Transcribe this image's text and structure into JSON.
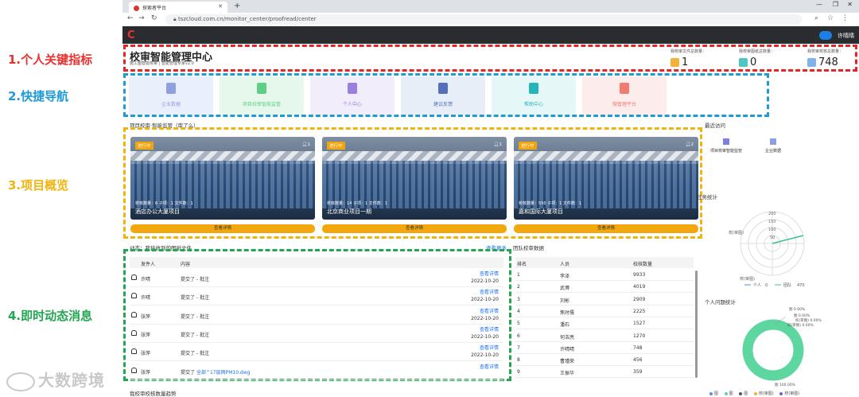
{
  "annotations": {
    "kpi": "1.个人关键指标",
    "nav": "2.快捷导航",
    "projects": "3.项目概览",
    "feed": "4.即时动态消息"
  },
  "watermark": "大数跨境",
  "browser": {
    "tab_title": "探索者平台",
    "url": "tszcloud.com.cn/monitor_center/proofread/center"
  },
  "user": {
    "name": "许晴晴"
  },
  "header": {
    "title": "校审智能管理中心",
    "subtitle": "施工图智能校审 | 智能管理专家v2.0"
  },
  "kpis": [
    {
      "label": "我校审文件总数量：",
      "value": "1",
      "color": "#f5b23b"
    },
    {
      "label": "我校审图纸总数量：",
      "value": "0",
      "color": "#4fc6c3"
    },
    {
      "label": "我校审校核总数量：",
      "value": "748",
      "color": "#7fb2ea"
    }
  ],
  "nav": [
    {
      "label": "企业数据",
      "bg": "#eaf0fb",
      "icon": "#8f9fdf"
    },
    {
      "label": "项目校审智能监管",
      "bg": "#e6f8ec",
      "icon": "#5fcf86"
    },
    {
      "label": "个人中心",
      "bg": "#f1edfb",
      "icon": "#9a7fe0"
    },
    {
      "label": "建议反馈",
      "bg": "#e8eef8",
      "icon": "#5470b8"
    },
    {
      "label": "帮助中心",
      "bg": "#e6f7f8",
      "icon": "#25b5b8"
    },
    {
      "label": "微管理平台",
      "bg": "#fdecec",
      "icon": "#f07b70"
    }
  ],
  "projects_section": {
    "title": "项目校审·智能监管（审了么）"
  },
  "projects": [
    {
      "badge": "进行中",
      "count": "1",
      "stats": "校核数量：6   子项：1   文件数：1",
      "name": "酒店办公大厦项目",
      "button": "查看详情"
    },
    {
      "badge": "进行中",
      "count": "1",
      "stats": "校核数量：14   子项：1   文件数：1",
      "name": "北京商业项目一期",
      "button": "查看详情"
    },
    {
      "badge": "进行中",
      "count": "2",
      "stats": "校核数量：550   子项：1   文件数：1",
      "name": "嘉和国际大厦项目",
      "button": "查看详情"
    }
  ],
  "recent": {
    "title": "最近访问",
    "items": [
      "项目校审智能监管",
      "企业数据"
    ]
  },
  "task_stats": {
    "title": "任务统计",
    "ticks": [
      "200",
      "150",
      "100",
      "50"
    ],
    "labels": [
      "校(审图)",
      "校(审图)"
    ],
    "legend": [
      "个人",
      "0",
      "团队",
      "470"
    ]
  },
  "personal": {
    "title": "个人问题统计",
    "labels": [
      "图 0.00%",
      "图 0.00%",
      "校(审图) 0.00%",
      "校(审图) 0.00%"
    ],
    "bottom_label": "图 100.00%",
    "legend": [
      "图",
      "图",
      "图",
      "校(审图)",
      "校(审图)"
    ]
  },
  "feed": {
    "title": "动态：我接收到的图纸文件",
    "more": "查看更多",
    "col_sender": "发件人",
    "col_content": "内容",
    "rows": [
      {
        "sender": "许晴",
        "content": "提交了 - 批注",
        "link": "查看详情",
        "date": "2022-10-20"
      },
      {
        "sender": "许晴",
        "content": "提交了 - 批注",
        "link": "查看详情",
        "date": "2022-10-20"
      },
      {
        "sender": "张萍",
        "content": "提交了 - 批注",
        "link": "查看详情",
        "date": "2022-10-20"
      },
      {
        "sender": "张萍",
        "content": "提交了 - 批注",
        "link": "查看详情",
        "date": "2022-10-20"
      },
      {
        "sender": "张萍",
        "content": "提交了 - 批注",
        "link": "查看详情",
        "date": "2022-10-20"
      },
      {
        "sender": "张萍",
        "content": "提交了",
        "file": "全部^17层网PM10.dwg",
        "link": "查看详情",
        "date": ""
      }
    ]
  },
  "team": {
    "title": "团队校审数据",
    "col_rank": "排名",
    "col_person": "人员",
    "col_count": "校核数量",
    "rows": [
      {
        "rank": "1",
        "name": "李泽",
        "count": "9933"
      },
      {
        "rank": "2",
        "name": "武博",
        "count": "4019"
      },
      {
        "rank": "3",
        "name": "刘彬",
        "count": "2909"
      },
      {
        "rank": "4",
        "name": "焦时儒",
        "count": "2225"
      },
      {
        "rank": "5",
        "name": "潘石",
        "count": "1527"
      },
      {
        "rank": "6",
        "name": "何浩亮",
        "count": "1270"
      },
      {
        "rank": "7",
        "name": "许晴晴",
        "count": "748"
      },
      {
        "rank": "8",
        "name": "曹瑾荣",
        "count": "456"
      },
      {
        "rank": "9",
        "name": "王振华",
        "count": "359"
      }
    ]
  },
  "footer_section": {
    "title": "我校审校核数量趋势"
  }
}
